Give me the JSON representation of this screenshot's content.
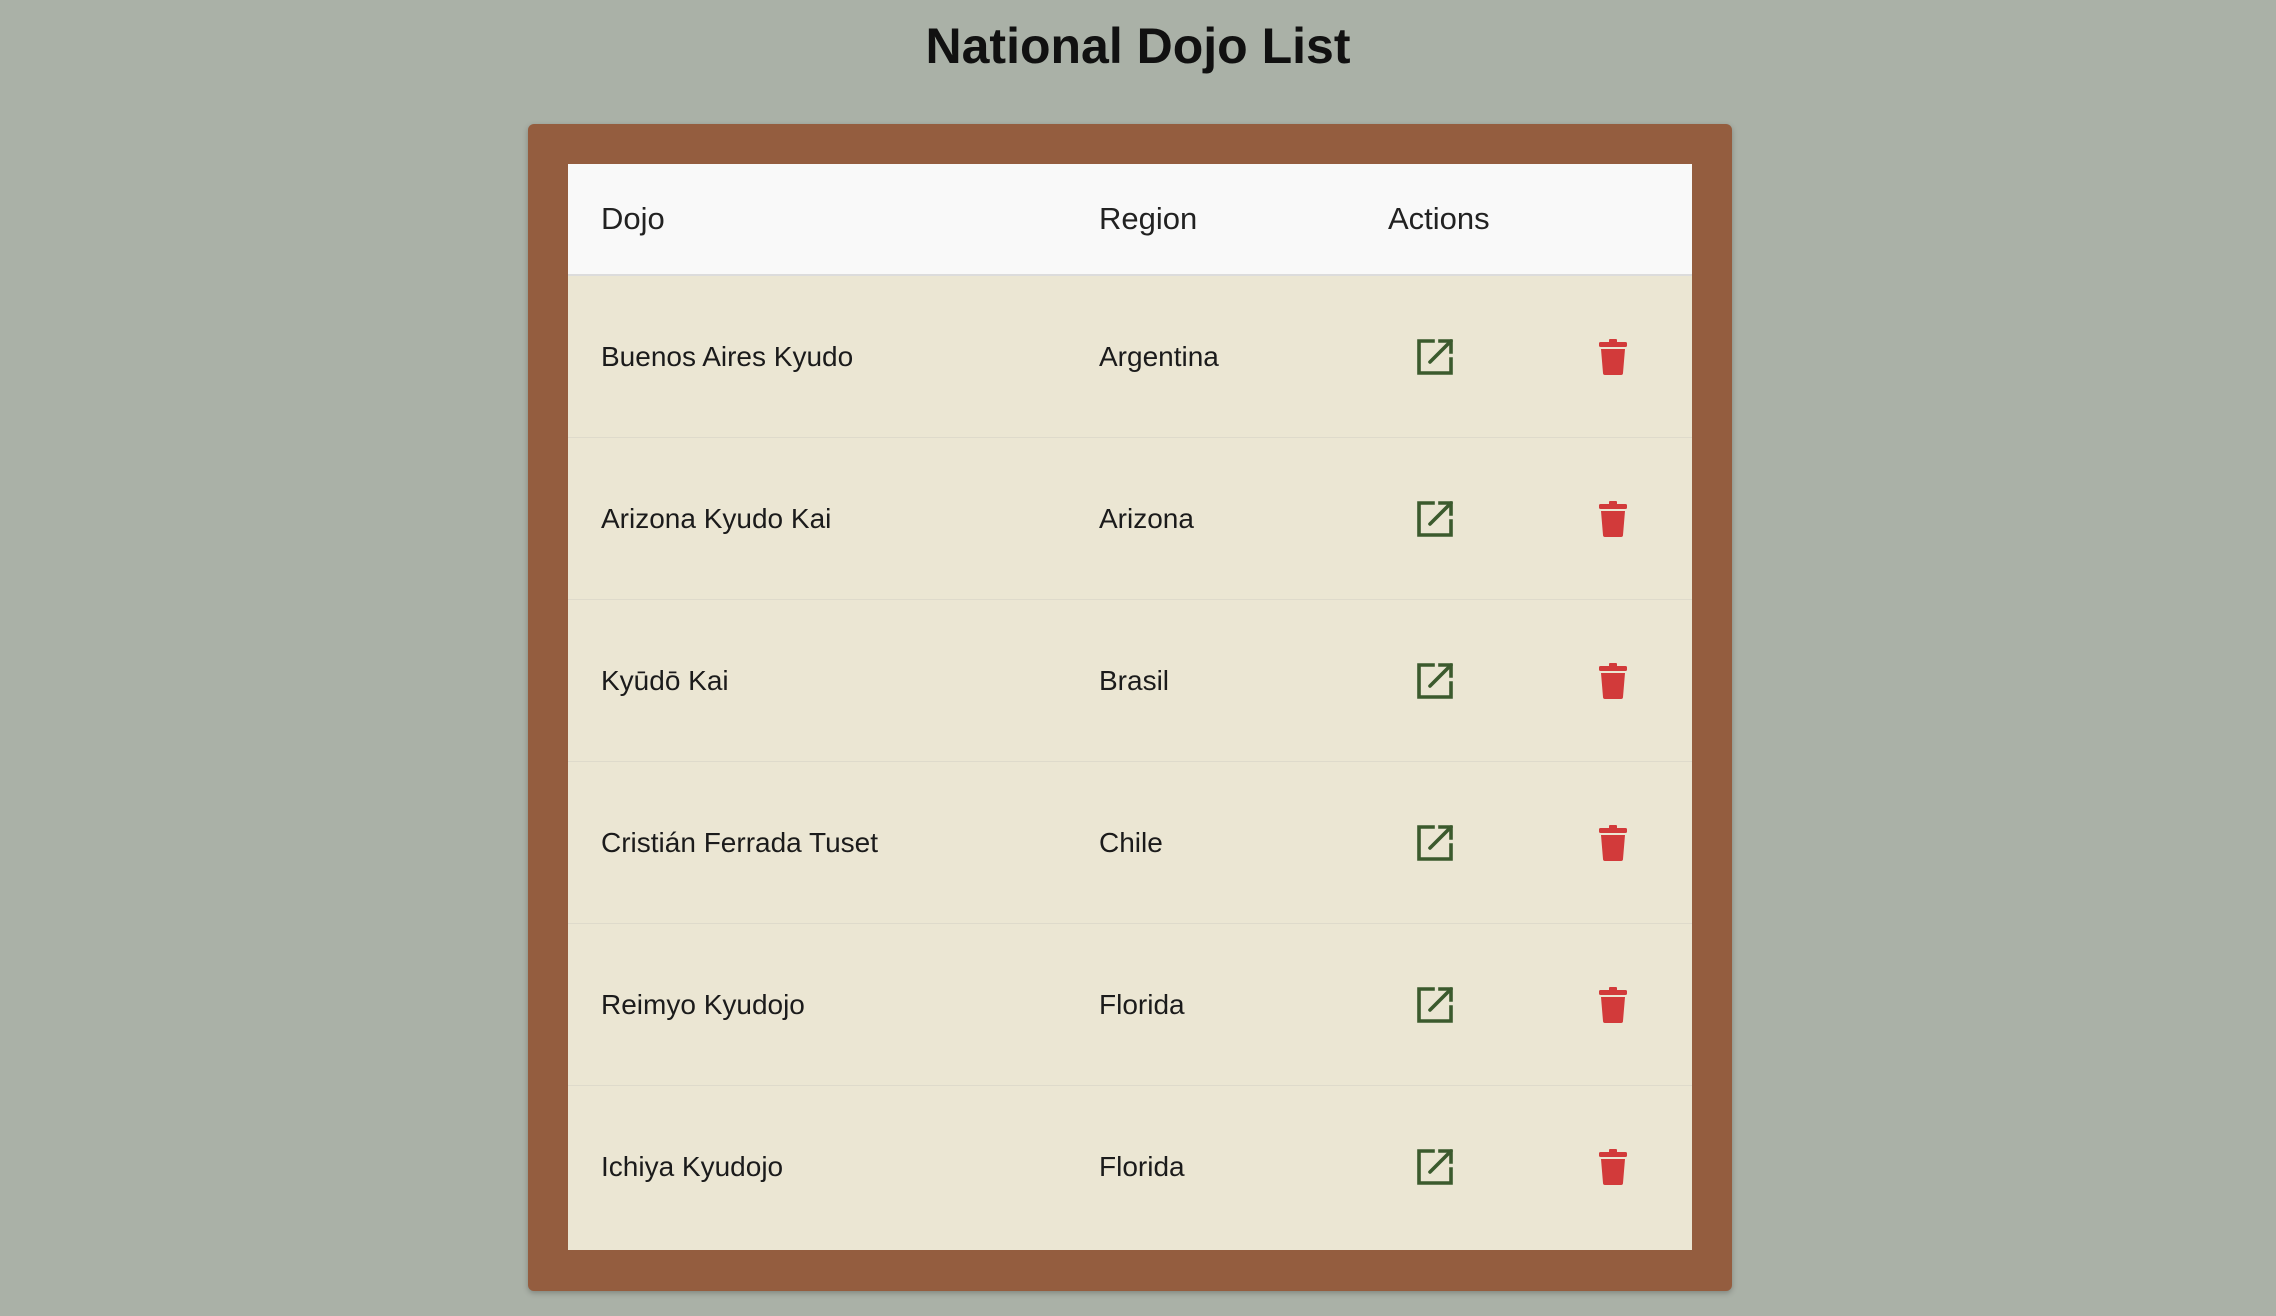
{
  "page": {
    "title": "National Dojo List",
    "background_color": "#aab1a7",
    "frame_color": "#945d3f"
  },
  "table": {
    "headers": {
      "dojo": "Dojo",
      "region": "Region",
      "actions": "Actions"
    },
    "rows": [
      {
        "dojo": "Buenos Aires Kyudo",
        "region": "Argentina"
      },
      {
        "dojo": "Arizona Kyudo Kai",
        "region": "Arizona"
      },
      {
        "dojo": "Kyūdō Kai",
        "region": "Brasil"
      },
      {
        "dojo": "Cristián Ferrada Tuset",
        "region": "Chile"
      },
      {
        "dojo": "Reimyo Kyudojo",
        "region": "Florida"
      },
      {
        "dojo": "Ichiya Kyudojo",
        "region": "Florida"
      }
    ],
    "row_actions": [
      {
        "icon": "edit-external-icon",
        "color": "#3b5a2d"
      },
      {
        "icon": "trash-icon",
        "color": "#d23a3a"
      }
    ]
  }
}
